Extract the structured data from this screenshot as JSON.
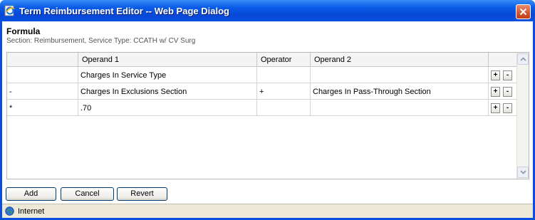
{
  "window": {
    "title": "Term Reimbursement Editor -- Web Page Dialog",
    "app_icon": "ie-page-icon",
    "close_icon": "close-x-icon"
  },
  "formula": {
    "title": "Formula",
    "section_line": "Section: Reimbursement, Service Type: CCATH w/ CV Surg"
  },
  "grid": {
    "columns": [
      "",
      "Operand 1",
      "Operator",
      "Operand 2"
    ],
    "rows": [
      {
        "leading": "",
        "operand1": "Charges In Service Type",
        "operator": "",
        "operand2": ""
      },
      {
        "leading": "-",
        "operand1": "Charges In Exclusions Section",
        "operator": "+",
        "operand2": "Charges In Pass-Through Section"
      },
      {
        "leading": "*",
        "operand1": ".70",
        "operator": "",
        "operand2": ""
      }
    ],
    "row_add_label": "+",
    "row_remove_label": "-"
  },
  "footer": {
    "add_label": "Add",
    "cancel_label": "Cancel",
    "revert_label": "Revert"
  },
  "status": {
    "zone_label": "Internet",
    "zone_icon": "globe-icon"
  }
}
